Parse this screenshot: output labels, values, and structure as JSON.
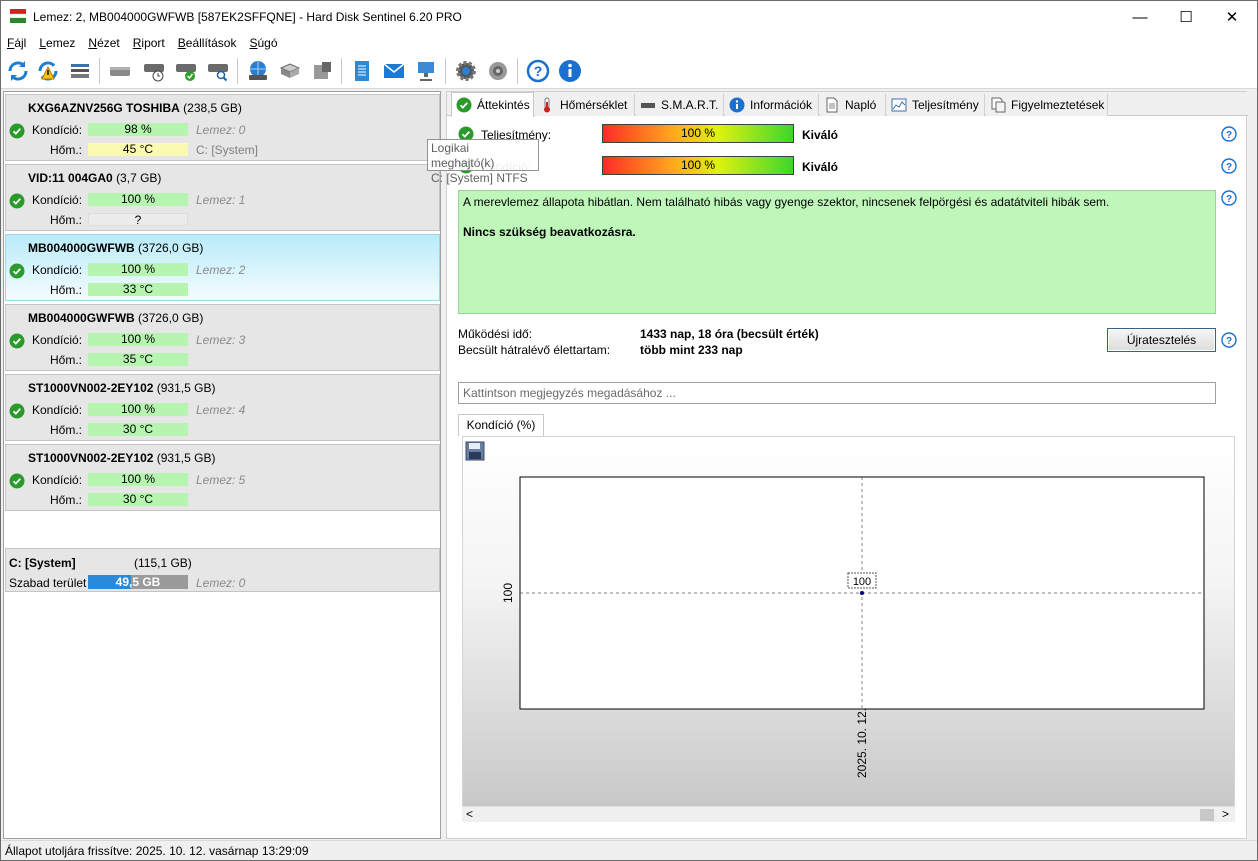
{
  "window": {
    "title": "Lemez: 2, MB004000GWFWB [587EK2SFFQNE] - Hard Disk Sentinel 6.20 PRO",
    "controls": {
      "minimize": "—",
      "maximize": "☐",
      "close": "✕"
    }
  },
  "menu": [
    {
      "key": "F",
      "rest": "ájl"
    },
    {
      "key": "L",
      "rest": "emez"
    },
    {
      "key": "N",
      "rest": "ézet"
    },
    {
      "key": "R",
      "rest": "iport"
    },
    {
      "key": "B",
      "rest": "eállítások"
    },
    {
      "key": "S",
      "rest": "úgó"
    }
  ],
  "toolbar_icons": [
    "refresh-icon",
    "refresh-warning-icon",
    "disk-list-icon",
    "disk-icon",
    "disk-clock-icon",
    "disk-check-icon",
    "disk-search-icon",
    "globe-disk-icon",
    "network-disk-icon",
    "usb-disk-icon",
    "notes-icon",
    "mail-icon",
    "network-icon",
    "settings-gear-icon",
    "speaker-icon",
    "help-icon",
    "info-icon"
  ],
  "disks": [
    {
      "name": "KXG6AZNV256G TOSHIBA",
      "size": "(238,5 GB)",
      "health_label": "Kondíció:",
      "health": "98 %",
      "health_fraction": 0.98,
      "temp_label": "Hőm.:",
      "temp": "45 °C",
      "temp_color": "yellow",
      "disk_index": "Lemez: 0",
      "partition": "C: [System]",
      "selected": false
    },
    {
      "name": "VID:11  004GA0",
      "size": "(3,7 GB)",
      "health_label": "Kondíció:",
      "health": "100 %",
      "health_fraction": 1.0,
      "temp_label": "Hőm.:",
      "temp": "?",
      "temp_color": "gray",
      "disk_index": "Lemez: 1",
      "partition": "",
      "selected": false
    },
    {
      "name": "MB004000GWFWB",
      "size": "(3726,0 GB)",
      "health_label": "Kondíció:",
      "health": "100 %",
      "health_fraction": 1.0,
      "temp_label": "Hőm.:",
      "temp": "33 °C",
      "temp_color": "green",
      "disk_index": "Lemez: 2",
      "partition": "",
      "selected": true
    },
    {
      "name": "MB004000GWFWB",
      "size": "(3726,0 GB)",
      "health_label": "Kondíció:",
      "health": "100 %",
      "health_fraction": 1.0,
      "temp_label": "Hőm.:",
      "temp": "35 °C",
      "temp_color": "green",
      "disk_index": "Lemez: 3",
      "partition": "",
      "selected": false
    },
    {
      "name": "ST1000VN002-2EY102",
      "size": "(931,5 GB)",
      "health_label": "Kondíció:",
      "health": "100 %",
      "health_fraction": 1.0,
      "temp_label": "Hőm.:",
      "temp": "30 °C",
      "temp_color": "green",
      "disk_index": "Lemez: 4",
      "partition": "",
      "selected": false
    },
    {
      "name": "ST1000VN002-2EY102",
      "size": "(931,5 GB)",
      "health_label": "Kondíció:",
      "health": "100 %",
      "health_fraction": 1.0,
      "temp_label": "Hőm.:",
      "temp": "30 °C",
      "temp_color": "green",
      "disk_index": "Lemez: 5",
      "partition": "",
      "selected": false
    }
  ],
  "system_drive": {
    "name": "C: [System]",
    "size": "(115,1 GB)",
    "free_label": "Szabad terület",
    "free": "49,5 GB",
    "free_fraction": 0.43,
    "disk_index": "Lemez: 0"
  },
  "tooltip": {
    "line1": "Logikai meghajtó(k)",
    "line2": "C: [System] NTFS"
  },
  "tabs": [
    {
      "label": "Áttekintés",
      "icon": "check-icon",
      "active": true
    },
    {
      "label": "Hőmérséklet",
      "icon": "thermometer-icon",
      "active": false
    },
    {
      "label": "S.M.A.R.T.",
      "icon": "disk-small-icon",
      "active": false
    },
    {
      "label": "Információk",
      "icon": "info-icon",
      "active": false
    },
    {
      "label": "Napló",
      "icon": "log-icon",
      "active": false
    },
    {
      "label": "Teljesítmény",
      "icon": "performance-chart-icon",
      "active": false
    },
    {
      "label": "Figyelmeztetések",
      "icon": "alerts-icon",
      "active": false
    }
  ],
  "overview": {
    "performance_label": "Teljesítmény:",
    "performance_value": "100 %",
    "performance_fraction": 1.0,
    "performance_rating": "Kiváló",
    "health_label": "Kondíció:",
    "health_value": "100 %",
    "health_fraction": 1.0,
    "health_rating": "Kiváló",
    "status_text": "A merevlemez állapota hibátlan. Nem található hibás vagy gyenge szektor, nincsenek felpörgési és adatátviteli hibák sem.",
    "status_action": "Nincs szükség beavatkozásra.",
    "uptime_label": "Működési idő:",
    "uptime_value": "1433 nap, 18 óra (becsült érték)",
    "lifetime_label": "Becsült hátralévő élettartam:",
    "lifetime_value": "több mint 233 nap",
    "retest_button": "Újratesztelés",
    "note_placeholder": "Kattintson megjegyzés megadásához ..."
  },
  "chart_tab": "Kondíció  (%)",
  "chart_data": {
    "type": "line",
    "x": [
      "2025. 10. 12."
    ],
    "series": [
      {
        "values": [
          100
        ]
      }
    ],
    "data_labels": [
      "100"
    ],
    "y_tick_labels": [
      "100"
    ],
    "x_tick_labels": [
      "2025. 10. 12."
    ],
    "grid": true,
    "legend": "none"
  },
  "scroll": {
    "left": "<",
    "right": ">"
  },
  "statusbar": "Állapot utoljára frissítve: 2025. 10. 12. vasárnap 13:29:09"
}
